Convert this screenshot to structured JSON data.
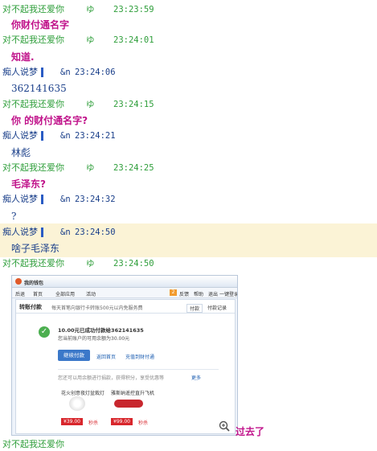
{
  "colors": {
    "green": "#2e9e3a",
    "blue": "#1a3f8a",
    "pink": "#c0128a",
    "highlight": "#fbf3d6"
  },
  "chat": {
    "h1": {
      "name": "对不起我还爱你",
      "icon": "ゆ",
      "time": "23:23:59"
    },
    "m1": "你财付通名字",
    "h2": {
      "name": "对不起我还爱你",
      "icon": "ゆ",
      "time": "23:24:01"
    },
    "m2": "知道.",
    "h3": {
      "name": "痴人说梦",
      "tag": "&n",
      "time": "23:24:06"
    },
    "m3": "362141635",
    "h4": {
      "name": "对不起我还爱你",
      "icon": "ゆ",
      "time": "23:24:15"
    },
    "m4": "你 的财付通名字?",
    "h5": {
      "name": "痴人说梦",
      "tag": "&n",
      "time": "23:24:21"
    },
    "m5": "林彪",
    "h6": {
      "name": "对不起我还爱你",
      "icon": "ゆ",
      "time": "23:24:25"
    },
    "m6": "毛泽东?",
    "h7": {
      "name": "痴人说梦",
      "tag": "&n",
      "time": "23:24:32"
    },
    "m7": "?",
    "h8": {
      "name": "痴人说梦",
      "tag": "&n",
      "time": "23:24:50"
    },
    "m8": "啥子毛泽东",
    "h9": {
      "name": "对不起我还爱你",
      "icon": "ゆ",
      "time": "23:24:50"
    },
    "m9": "过去了",
    "h10": {
      "name": "对不起我还爱你"
    }
  },
  "wallet": {
    "title": "我的钱包",
    "nav": [
      "后退",
      "首页",
      "全部应用",
      "活动"
    ],
    "right_links": [
      "反馈",
      "帮助",
      "退出",
      "一键登录"
    ],
    "badge": "2",
    "section_title": "转账付款",
    "notice": "每天首笔向银行卡转账500元以内免服务费",
    "tabs": [
      "付款",
      "付款记录"
    ],
    "success_title": "10.00元已成功付款给362141635",
    "success_sub": "您当前账户的可用余额为30.00元",
    "continue_btn": "继续付款",
    "link1": "返回首页",
    "link2": "充值到财付通",
    "hint": "您还可以用余额进行捐款，获得积分，享受优惠等",
    "more": "更多",
    "product1": {
      "name": "花火创意夜灯盆栽灯",
      "price": "¥39.00",
      "tag": "秒杀"
    },
    "product2": {
      "name": "雅斯纳遥控直升飞机",
      "price": "¥99.00",
      "tag": "秒杀"
    }
  }
}
